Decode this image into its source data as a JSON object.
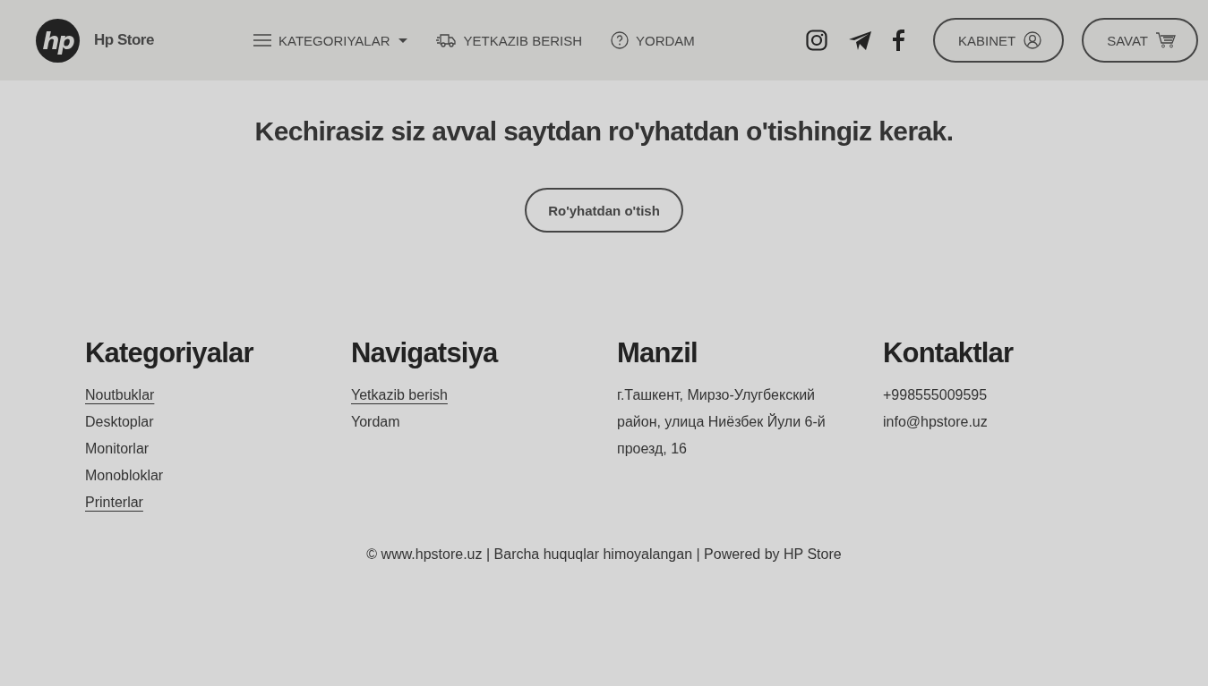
{
  "header": {
    "logo_text": "hp",
    "brand": "Hp Store",
    "nav": [
      {
        "kind": "menu",
        "label": "KATEGORIYALAR"
      },
      {
        "kind": "delivery",
        "label": "YETKAZIB BERISH"
      },
      {
        "kind": "help",
        "label": "YORDAM"
      }
    ],
    "social": [
      {
        "kind": "instagram"
      },
      {
        "kind": "telegram"
      },
      {
        "kind": "facebook"
      }
    ],
    "buttons": [
      {
        "kind": "account",
        "label": "KABINET"
      },
      {
        "kind": "cart",
        "label": "SAVAT"
      }
    ]
  },
  "notice": {
    "message": "Kechirasiz siz avval saytdan ro'yhatdan o'tishingiz kerak.",
    "button": "Ro'yhatdan o'tish"
  },
  "footer": {
    "columns": [
      {
        "title": "Kategoriyalar",
        "kind": "links",
        "items": [
          {
            "text": "Noutbuklar",
            "underlined": true
          },
          {
            "text": "Desktoplar",
            "underlined": false
          },
          {
            "text": "Monitorlar",
            "underlined": false
          },
          {
            "text": "Monobloklar",
            "underlined": false
          },
          {
            "text": "Printerlar",
            "underlined": true
          }
        ]
      },
      {
        "title": "Navigatsiya",
        "kind": "links",
        "items": [
          {
            "text": "Yetkazib berish",
            "underlined": true
          },
          {
            "text": "Yordam",
            "underlined": false
          }
        ]
      },
      {
        "title": "Manzil",
        "kind": "text",
        "text": "г.Ташкент, Мирзо-Улугбекский район, улица Ниёзбек Йули 6-й проезд, 16"
      },
      {
        "title": "Kontaktlar",
        "kind": "links",
        "items": [
          {
            "text": "+998555009595",
            "underlined": false
          },
          {
            "text": "info@hpstore.uz",
            "underlined": false
          }
        ]
      }
    ],
    "copyright": "© www.hpstore.uz | Barcha huquqlar himoyalangan | Powered by HP Store"
  }
}
